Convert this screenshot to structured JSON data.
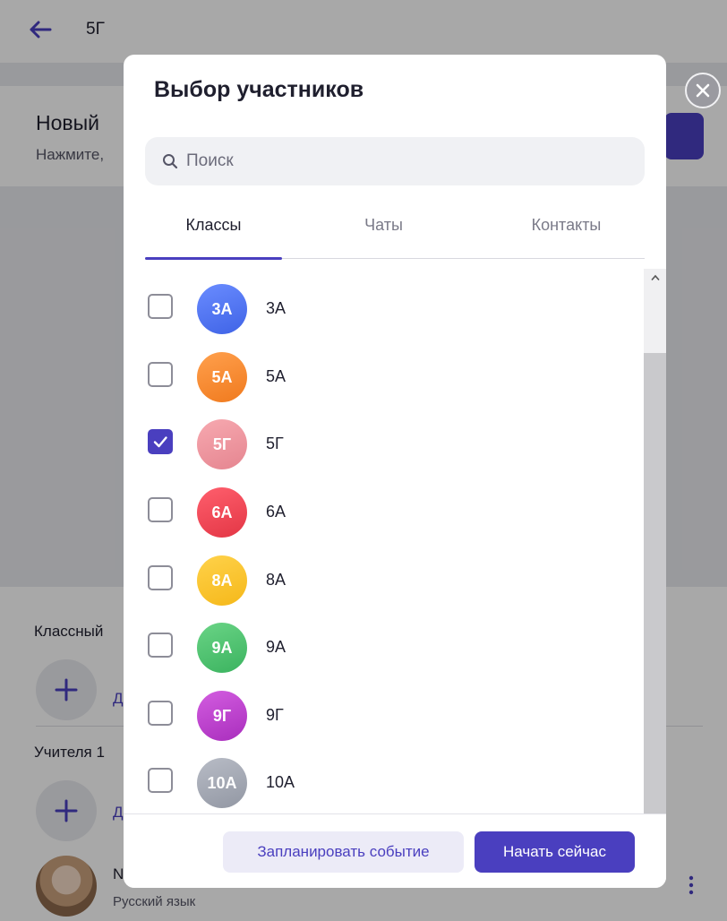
{
  "background": {
    "header_title": "5Г",
    "card_title": "Новый",
    "card_subtitle": "Нажмите,",
    "section_class_label": "Классный",
    "add_label_1": "Д",
    "teachers_label": "Учителя 1",
    "add_label_2": "Д",
    "teacher_initial": "N",
    "teacher_subject": "Русский язык"
  },
  "modal": {
    "title": "Выбор участников",
    "search_placeholder": "Поиск",
    "tabs": [
      {
        "label": "Классы",
        "active": true
      },
      {
        "label": "Чаты",
        "active": false
      },
      {
        "label": "Контакты",
        "active": false
      }
    ],
    "items": [
      {
        "avatar": "3А",
        "label": "3А",
        "checked": false,
        "color_from": "#6a8cff",
        "color_to": "#3f63e6"
      },
      {
        "avatar": "5А",
        "label": "5А",
        "checked": false,
        "color_from": "#ffa04d",
        "color_to": "#f07a1e"
      },
      {
        "avatar": "5Г",
        "label": "5Г",
        "checked": true,
        "color_from": "#f7a9b0",
        "color_to": "#e58590"
      },
      {
        "avatar": "6А",
        "label": "6А",
        "checked": false,
        "color_from": "#ff5f6d",
        "color_to": "#e33645"
      },
      {
        "avatar": "8А",
        "label": "8А",
        "checked": false,
        "color_from": "#ffd24a",
        "color_to": "#f5b81a"
      },
      {
        "avatar": "9А",
        "label": "9А",
        "checked": false,
        "color_from": "#6ad486",
        "color_to": "#3bb35f"
      },
      {
        "avatar": "9Г",
        "label": "9Г",
        "checked": false,
        "color_from": "#d35de0",
        "color_to": "#a92ebd"
      },
      {
        "avatar": "10А",
        "label": "10А",
        "checked": false,
        "color_from": "#b8bcc6",
        "color_to": "#9297a3"
      }
    ],
    "secondary_button": "Запланировать событие",
    "primary_button": "Начать сейчас"
  },
  "colors": {
    "accent": "#4a3fbf"
  }
}
